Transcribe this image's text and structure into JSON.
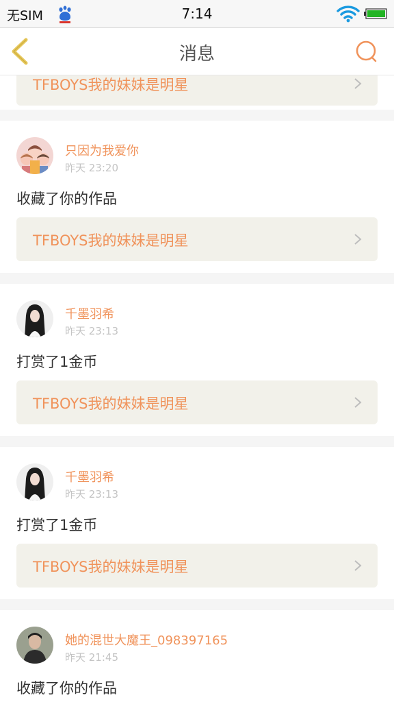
{
  "status_bar": {
    "carrier": "无SIM",
    "time": "7:14",
    "icons": [
      "baidu-paw-icon",
      "wifi-icon",
      "battery-icon"
    ]
  },
  "nav": {
    "title": "消息",
    "back_icon": "chevron-left-icon",
    "search_icon": "search-icon"
  },
  "colors": {
    "accent": "#f0935b",
    "back_arrow": "#e6c75a",
    "work_bg": "#f2f1ea",
    "page_bg": "#f5f5f5"
  },
  "partial_top_work": "TFBOYS我的妹妹是明星",
  "messages": [
    {
      "username": "只因为我爱你",
      "time": "昨天 23:20",
      "action": "收藏了你的作品",
      "work": "TFBOYS我的妹妹是明星"
    },
    {
      "username": "千墨羽希",
      "time": "昨天 23:13",
      "action": "打赏了1金币",
      "work": "TFBOYS我的妹妹是明星"
    },
    {
      "username": "千墨羽希",
      "time": "昨天 23:13",
      "action": "打赏了1金币",
      "work": "TFBOYS我的妹妹是明星"
    },
    {
      "username": "她的混世大魔王_098397165",
      "time": "昨天 21:45",
      "action": "收藏了你的作品"
    }
  ]
}
